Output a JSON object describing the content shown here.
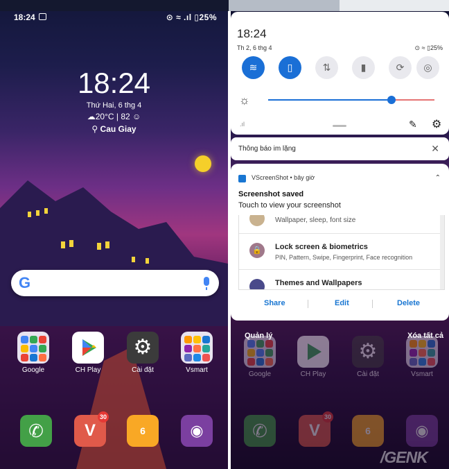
{
  "left_screen": {
    "status": {
      "time": "18:24",
      "right": "⊙ ≈ .ıl ▯25%"
    },
    "clock": {
      "time": "18:24",
      "date": "Thứ Hai, 6 thg 4",
      "weather": "☁20°C | 82 ☺",
      "location": "Cau Giay"
    },
    "search": {
      "logo": "G"
    },
    "apps": [
      {
        "label": "Google"
      },
      {
        "label": "CH Play"
      },
      {
        "label": "Cài đặt"
      },
      {
        "label": "Vsmart"
      }
    ],
    "dock": {
      "vivaldi_badge": "30"
    }
  },
  "right_screen": {
    "quick_settings": {
      "time": "18:24",
      "date": "Th 2, 6 thg 4",
      "status": "⊙ ≈ ▯25%",
      "brightness_level": 0.74
    },
    "silent_notice": {
      "title": "Thông báo im lặng"
    },
    "notification": {
      "app": "VScreenShot • bây giờ",
      "title": "Screenshot saved",
      "subtitle": "Touch to view your screenshot",
      "preview_rows": [
        {
          "title": "",
          "subtitle": "Wallpaper, sleep, font size"
        },
        {
          "title": "Lock screen & biometrics",
          "subtitle": "PIN, Pattern, Swipe, Fingerprint, Face recognition"
        },
        {
          "title": "Themes and Wallpapers",
          "subtitle": ""
        }
      ],
      "actions": {
        "share": "Share",
        "edit": "Edit",
        "delete": "Delete"
      }
    },
    "manage": "Quản lý",
    "clear_all": "Xóa tất cả",
    "apps": [
      {
        "label": "Google"
      },
      {
        "label": "CH Play"
      },
      {
        "label": "Cài đặt"
      },
      {
        "label": "Vsmart"
      }
    ],
    "dock": {
      "vivaldi_badge": "30"
    }
  },
  "watermark": "/GENK",
  "colors": {
    "accent": "#1a6fd6",
    "action": "#1976d2",
    "badge": "#e53935"
  }
}
